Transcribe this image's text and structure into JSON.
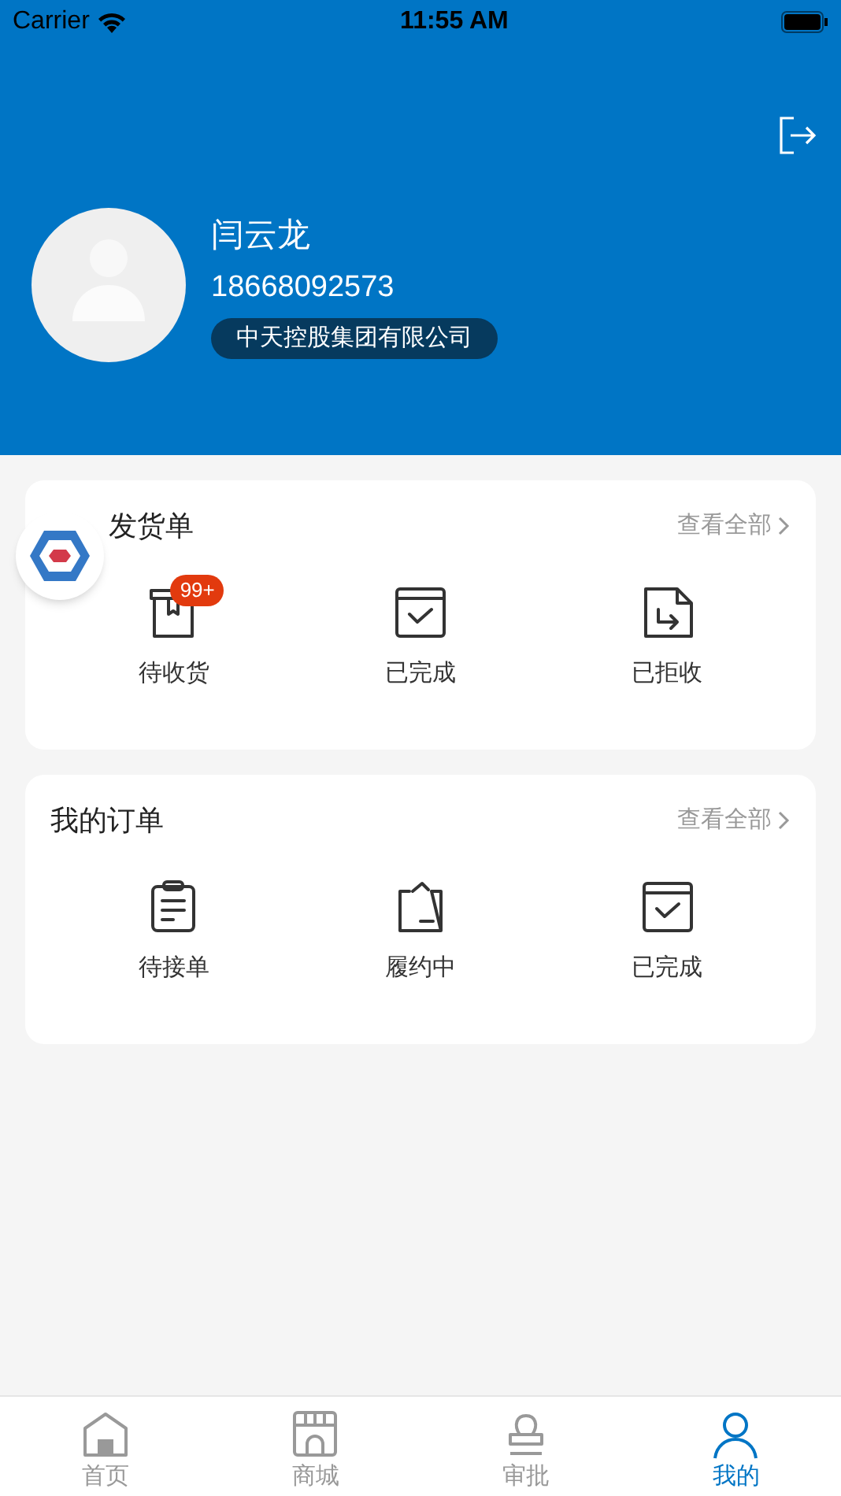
{
  "status_bar": {
    "carrier": "Carrier",
    "time": "11:55 AM"
  },
  "profile": {
    "name": "闫云龙",
    "phone": "18668092573",
    "company": "中天控股集团有限公司"
  },
  "sections": [
    {
      "title": "发货单",
      "view_all": "查看全部",
      "items": [
        {
          "kind": "to-receive",
          "label": "待收货",
          "badge": "99+"
        },
        {
          "kind": "done",
          "label": "已完成"
        },
        {
          "kind": "rejected",
          "label": "已拒收"
        }
      ]
    },
    {
      "title": "我的订单",
      "view_all": "查看全部",
      "items": [
        {
          "kind": "to-accept",
          "label": "待接单"
        },
        {
          "kind": "in-progress",
          "label": "履约中"
        },
        {
          "kind": "done",
          "label": "已完成"
        }
      ]
    }
  ],
  "tab_bar": [
    {
      "kind": "home",
      "label": "首页",
      "selected": false
    },
    {
      "kind": "mall",
      "label": "商城",
      "selected": false
    },
    {
      "kind": "approval",
      "label": "审批",
      "selected": false
    },
    {
      "kind": "mine",
      "label": "我的",
      "selected": true
    }
  ]
}
